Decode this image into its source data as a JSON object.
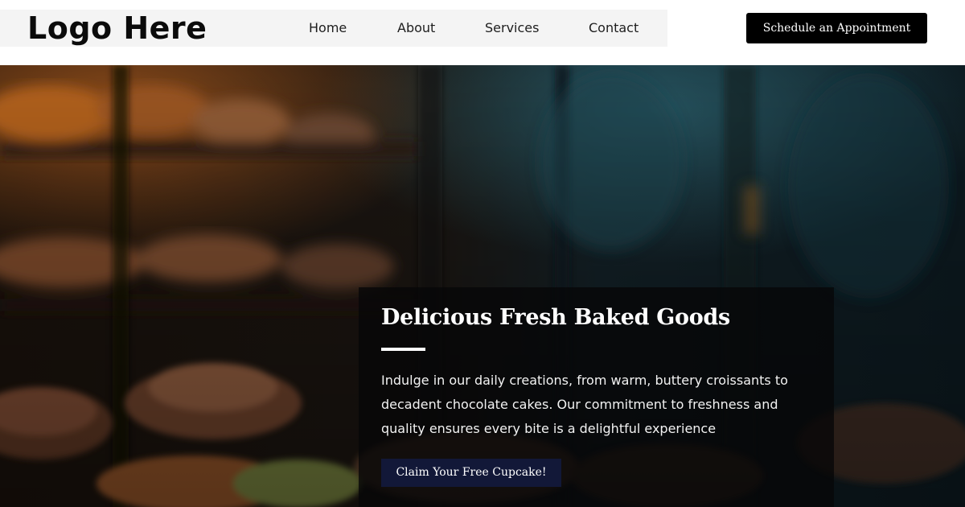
{
  "header": {
    "logo_text": "Logo Here",
    "nav": [
      {
        "label": "Home"
      },
      {
        "label": "About"
      },
      {
        "label": "Services"
      },
      {
        "label": "Contact"
      }
    ],
    "cta_label": "Schedule an Appointment"
  },
  "hero": {
    "title": "Delicious Fresh Baked Goods",
    "description": "Indulge in our daily creations, from warm, buttery croissants to decadent chocolate cakes. Our commitment to freshness and quality ensures every bite is a delightful experience",
    "button_label": "Claim Your Free Cupcake!"
  },
  "colors": {
    "header_bg": "#ffffff",
    "nav_strip_bg": "#f4f4f4",
    "cta_bg": "#000000",
    "card_bg": "#060608",
    "claim_button_bg": "#121838",
    "text_light": "#ffffff"
  },
  "icons": {
    "hero_background": "bakery-display-photo"
  }
}
